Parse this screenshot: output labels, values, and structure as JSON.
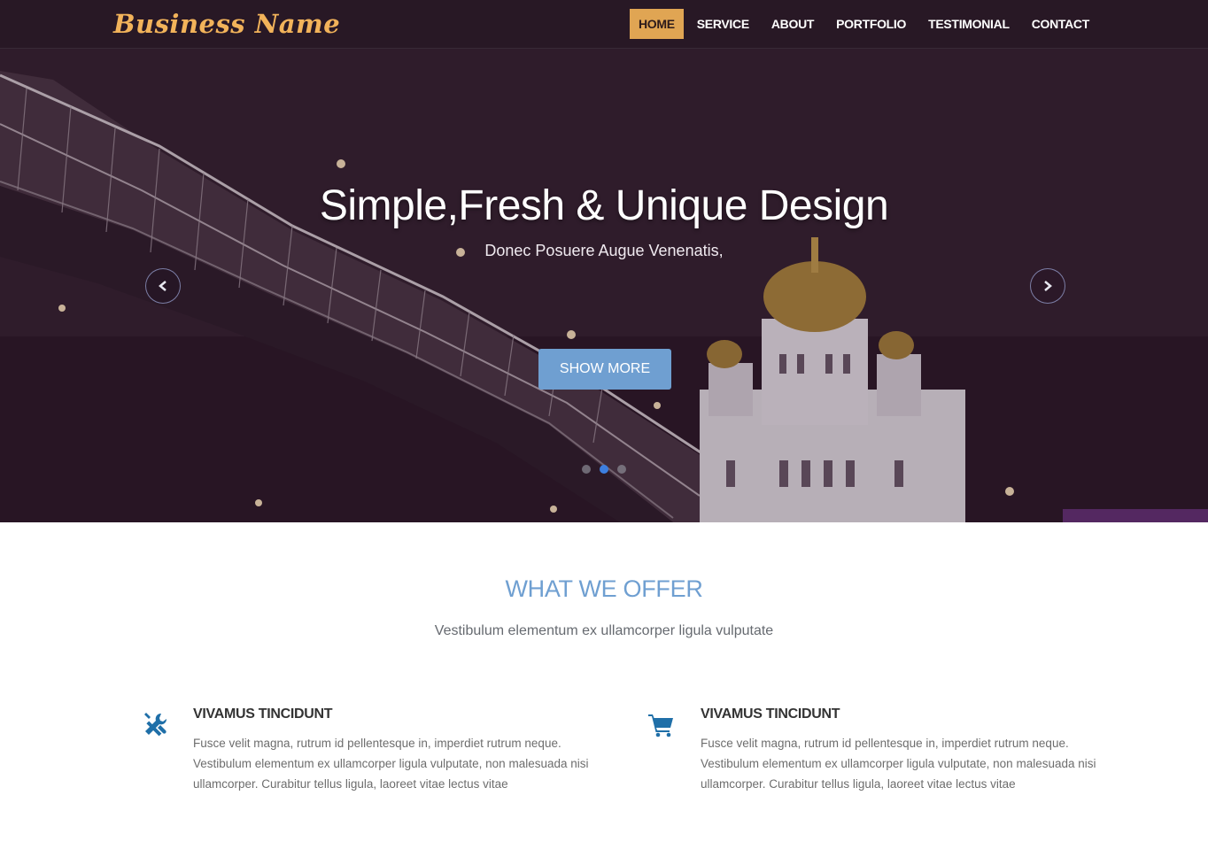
{
  "brand": {
    "name": "Business Name"
  },
  "nav": {
    "items": [
      {
        "label": "HOME",
        "active": true
      },
      {
        "label": "SERVICE",
        "active": false
      },
      {
        "label": "ABOUT",
        "active": false
      },
      {
        "label": "PORTFOLIO",
        "active": false
      },
      {
        "label": "TESTIMONIAL",
        "active": false
      },
      {
        "label": "CONTACT",
        "active": false
      }
    ]
  },
  "hero": {
    "title": "Simple,Fresh & Unique Design",
    "subtitle": "Donec Posuere Augue Venenatis,",
    "cta_label": "SHOW MORE",
    "prev_icon": "chevron-left-icon",
    "next_icon": "chevron-right-icon",
    "slide_count": 3,
    "active_slide": 2
  },
  "offer": {
    "title": "WHAT WE OFFER",
    "subtitle": "Vestibulum elementum ex ullamcorper ligula vulputate",
    "features": [
      {
        "icon": "tools-icon",
        "title": "VIVAMUS TINCIDUNT",
        "text": "Fusce velit magna, rutrum id pellentesque in, imperdiet rutrum neque. Vestibulum elementum ex ullamcorper ligula vulputate, non malesuada nisi ullamcorper. Curabitur tellus ligula, laoreet vitae lectus vitae"
      },
      {
        "icon": "cart-icon",
        "title": "VIVAMUS TINCIDUNT",
        "text": "Fusce velit magna, rutrum id pellentesque in, imperdiet rutrum neque. Vestibulum elementum ex ullamcorper ligula vulputate, non malesuada nisi ullamcorper. Curabitur tellus ligula, laoreet vitae lectus vitae"
      }
    ]
  },
  "colors": {
    "brand": "#f2b35a",
    "nav_active": "#e0a553",
    "accent": "#6f9fd1",
    "icon": "#1f6fa8",
    "dot_active": "#3d7fe0"
  }
}
